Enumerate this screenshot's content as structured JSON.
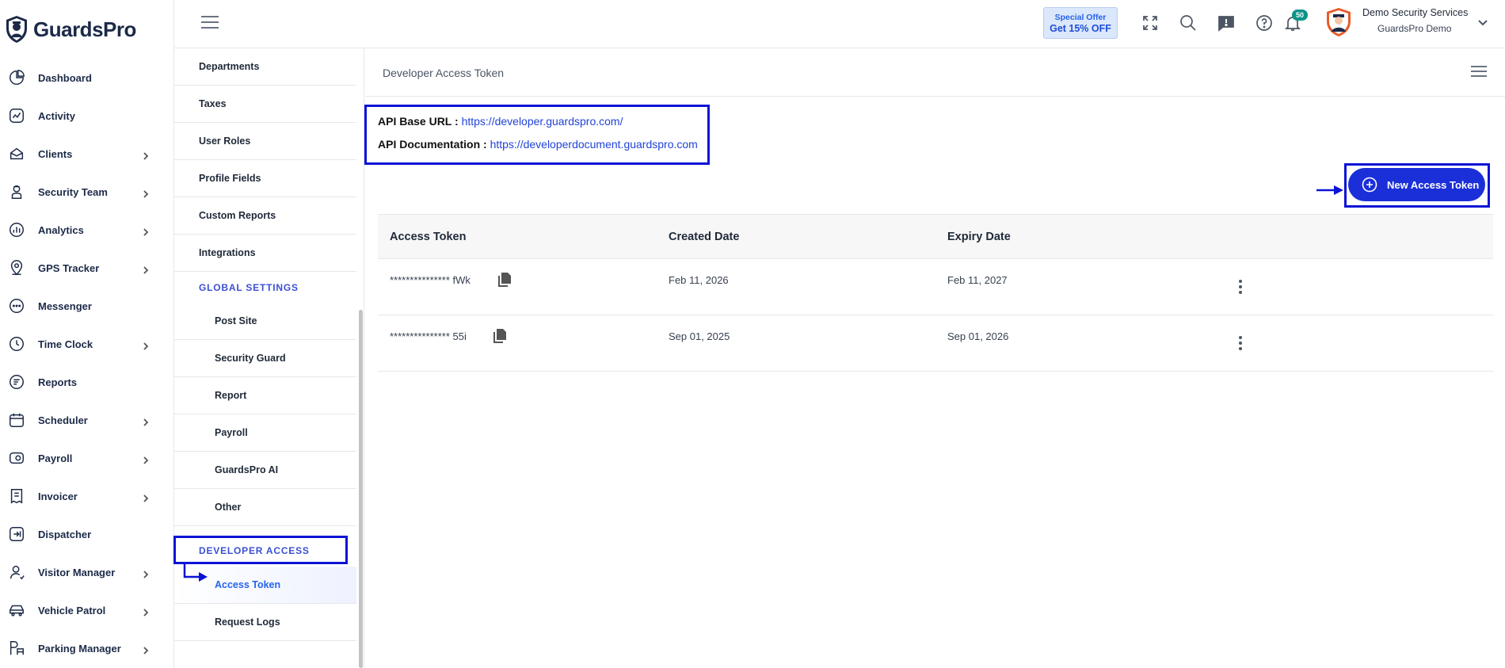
{
  "brand": {
    "name": "GuardsPro"
  },
  "sidebar": {
    "items": [
      {
        "label": "Dashboard",
        "icon": "dashboard-icon",
        "has_children": false
      },
      {
        "label": "Activity",
        "icon": "activity-icon",
        "has_children": false
      },
      {
        "label": "Clients",
        "icon": "clients-icon",
        "has_children": true
      },
      {
        "label": "Security Team",
        "icon": "security-team-icon",
        "has_children": true
      },
      {
        "label": "Analytics",
        "icon": "analytics-icon",
        "has_children": true
      },
      {
        "label": "GPS Tracker",
        "icon": "gps-pin-icon",
        "has_children": true
      },
      {
        "label": "Messenger",
        "icon": "messenger-icon",
        "has_children": false
      },
      {
        "label": "Time Clock",
        "icon": "clock-icon",
        "has_children": true
      },
      {
        "label": "Reports",
        "icon": "reports-icon",
        "has_children": false
      },
      {
        "label": "Scheduler",
        "icon": "calendar-icon",
        "has_children": true
      },
      {
        "label": "Payroll",
        "icon": "payroll-icon",
        "has_children": true
      },
      {
        "label": "Invoicer",
        "icon": "invoice-icon",
        "has_children": true
      },
      {
        "label": "Dispatcher",
        "icon": "dispatcher-icon",
        "has_children": false
      },
      {
        "label": "Visitor Manager",
        "icon": "visitor-icon",
        "has_children": true
      },
      {
        "label": "Vehicle Patrol",
        "icon": "car-icon",
        "has_children": true
      },
      {
        "label": "Parking Manager",
        "icon": "parking-icon",
        "has_children": true
      }
    ]
  },
  "header": {
    "offer_line1": "Special Offer",
    "offer_line2": "Get 15% OFF",
    "notification_count": "50",
    "user_name": "Demo Security Services",
    "user_org": "GuardsPro Demo"
  },
  "settings_menu": {
    "top_items": [
      "Departments",
      "Taxes",
      "User Roles",
      "Profile Fields",
      "Custom Reports",
      "Integrations"
    ],
    "global_title": "GLOBAL SETTINGS",
    "global_items": [
      "Post Site",
      "Security Guard",
      "Report",
      "Payroll",
      "GuardsPro AI",
      "Other"
    ],
    "developer_title": "DEVELOPER ACCESS",
    "developer_items": [
      "Access Token",
      "Request Logs"
    ],
    "active_item": "Access Token"
  },
  "page": {
    "title": "Developer Access Token",
    "api_base_label": "API Base URL :",
    "api_base_url": "https://developer.guardspro.com/",
    "api_doc_label": "API Documentation :",
    "api_doc_url": "https://developerdocument.guardspro.com",
    "new_token_label": "New Access Token"
  },
  "table": {
    "columns": [
      "Access Token",
      "Created Date",
      "Expiry Date"
    ],
    "rows": [
      {
        "token": "*************** fWk",
        "created": "Feb 11, 2026",
        "expiry": "Feb 11, 2027"
      },
      {
        "token": "*************** 55i",
        "created": "Sep 01, 2025",
        "expiry": "Sep 01, 2026"
      }
    ]
  },
  "colors": {
    "accent": "#1b2fd9",
    "highlight": "#0b13d6",
    "brand_navy": "#1c2a48",
    "badge": "#0d9488"
  }
}
